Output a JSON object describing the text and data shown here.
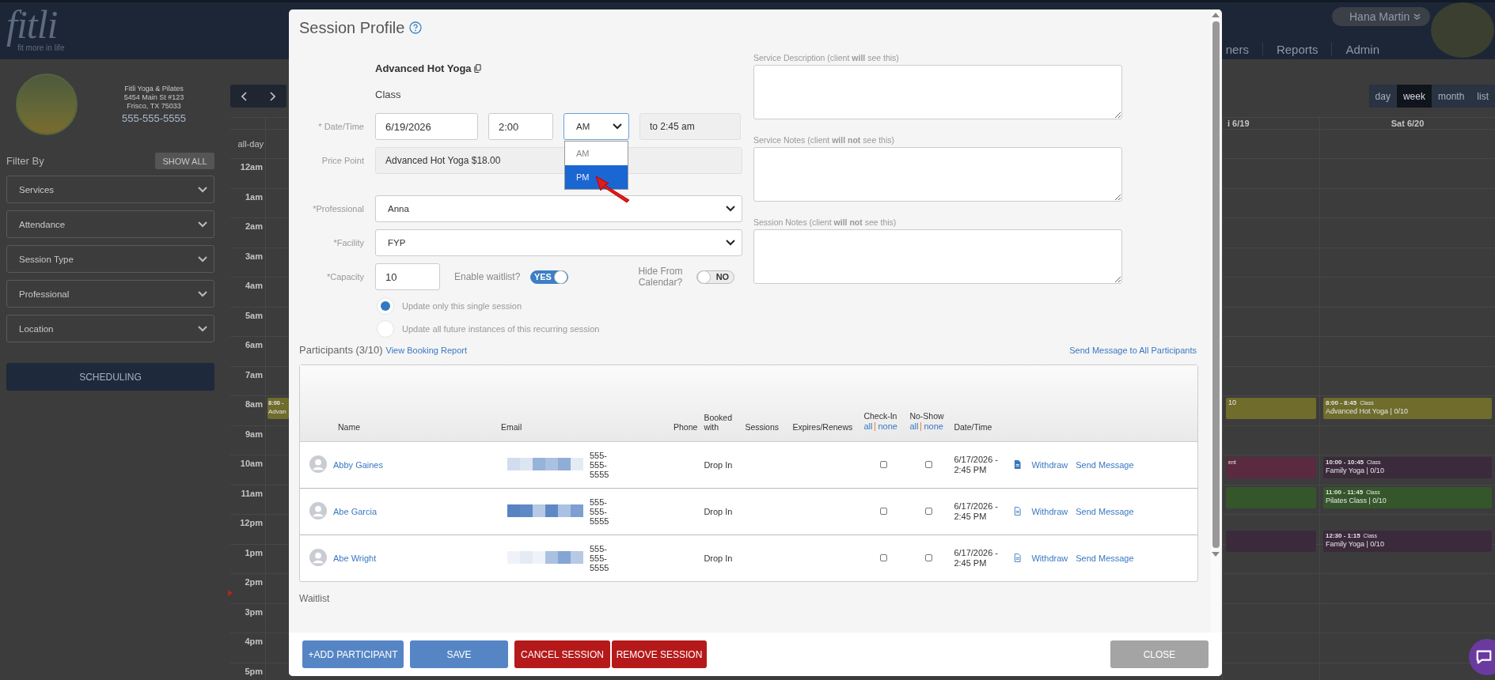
{
  "header": {
    "logo": "fitli",
    "tagline": "fit more in life",
    "nav": [
      "ners",
      "Reports",
      "Admin"
    ],
    "user": "Hana Martin"
  },
  "sidebar": {
    "business_name": "Fitli Yoga & Pilates",
    "address": "5454 Main St #123",
    "city": "Frisco, TX 75033",
    "phone": "555-555-5555",
    "filter_label": "Filter By",
    "show_all": "SHOW ALL",
    "filters": [
      "Services",
      "Attendance",
      "Session Type",
      "Professional",
      "Location"
    ],
    "scheduling": "SCHEDULING"
  },
  "calendar": {
    "views": [
      {
        "label": "day",
        "selected": false
      },
      {
        "label": "week",
        "selected": true
      },
      {
        "label": "month",
        "selected": false
      },
      {
        "label": "list",
        "selected": false
      }
    ],
    "days": {
      "fri": "i 6/19",
      "sat": "Sat 6/20"
    },
    "all_day": "all-day",
    "hours": [
      {
        "label": "12am"
      },
      {
        "label": "1am"
      },
      {
        "label": "2am"
      },
      {
        "label": "3am"
      },
      {
        "label": "4am"
      },
      {
        "label": "5am"
      },
      {
        "label": "6am"
      },
      {
        "label": "7am"
      },
      {
        "label": "8am",
        "sun": {
          "kind": "on-hour",
          "time": "8:00 -",
          "title": "Advan",
          "color": "#6f6c2c"
        },
        "fri": {
          "kind": "on-hour",
          "title": "10",
          "color": "#6f6c2c"
        },
        "sat": {
          "kind": "on-hour",
          "time": "8:00 - 8:45",
          "type": "Class",
          "title": "Advanced Hot Yoga | 0/10",
          "color": "#6f6c2c"
        }
      },
      {
        "label": "9am"
      },
      {
        "label": "10am",
        "fri": {
          "kind": "on-hour",
          "type": "ent",
          "color": "#5a2a40"
        },
        "sat": {
          "kind": "on-hour",
          "time": "10:00 - 10:45",
          "type": "Class",
          "title": "Family Yoga | 0/10",
          "color": "#3b2a3c"
        }
      },
      {
        "label": "11am",
        "fri": {
          "kind": "on-hour",
          "color": "#35562b"
        },
        "sat": {
          "kind": "on-hour",
          "time": "11:00 - 11:45",
          "type": "Class",
          "title": "Pilates Class | 0/10",
          "color": "#35562b"
        }
      },
      {
        "label": "12pm",
        "fri": {
          "kind": "half-past",
          "color": "#3b2a3c"
        },
        "sat": {
          "kind": "half-past",
          "time": "12:30 - 1:15",
          "type": "Class",
          "title": "Family Yoga | 0/10",
          "color": "#3b2a3c"
        }
      },
      {
        "label": "1pm"
      },
      {
        "label": "2pm"
      },
      {
        "label": "3pm"
      },
      {
        "label": "4pm"
      },
      {
        "label": "5pm"
      }
    ]
  },
  "modal": {
    "title": "Session Profile",
    "service_name": "Advanced Hot Yoga",
    "service_type": "Class",
    "date_label": "* Date/Time",
    "date": "6/19/2026",
    "time": "2:00",
    "meridiem": "AM",
    "meridiem_options": [
      {
        "label": "AM",
        "selected": false
      },
      {
        "label": "PM",
        "selected": true
      }
    ],
    "end_time": "to 2:45 am",
    "price_label": "Price Point",
    "price": "Advanced Hot Yoga $18.00",
    "professional_label": "*Professional",
    "professional": "Anna",
    "facility_label": "*Facility",
    "facility": "FYP",
    "capacity_label": "*Capacity",
    "capacity": "10",
    "waitlist_label": "Enable waitlist?",
    "waitlist": {
      "label": "YES",
      "on": true
    },
    "hide_label": "Hide From Calendar?",
    "hide": {
      "label": "NO",
      "on": false
    },
    "update_options": [
      {
        "label": "Update only this single session",
        "selected": true
      },
      {
        "label": "Update all future instances of this recurring session",
        "selected": false
      }
    ],
    "notes": [
      {
        "label": "Service Description (client **will** see this)"
      },
      {
        "label": "Service Notes (client **will not** see this)"
      },
      {
        "label": "Session Notes (client **will not** see this)"
      }
    ],
    "participants_title": "Participants (3/10)",
    "booking_report": "View Booking Report",
    "send_all": "Send Message to All Participants",
    "columns": {
      "name": "Name",
      "email": "Email",
      "phone": "Phone",
      "booked": "Booked with",
      "sessions": "Sessions",
      "expires": "Expires/Renews",
      "check_in": "Check-In",
      "check_in_all": "all",
      "check_in_none": "none",
      "no_show": "No-Show",
      "no_show_all": "all",
      "no_show_none": "none",
      "datetime": "Date/Time"
    },
    "participants": [
      {
        "name": "Abby Gaines",
        "phone": "555-555-5555",
        "booked": "Drop In",
        "checked_in": false,
        "no_show": false,
        "datetime": "6/17/2026 - 2:45 PM",
        "note_filled": true,
        "withdraw": "Withdraw",
        "message": "Send Message"
      },
      {
        "name": "Abe Garcia",
        "phone": "555-555-5555",
        "booked": "Drop In",
        "checked_in": false,
        "no_show": false,
        "datetime": "6/17/2026 - 2:45 PM",
        "note_filled": false,
        "withdraw": "Withdraw",
        "message": "Send Message"
      },
      {
        "name": "Abe Wright",
        "phone": "555-555-5555",
        "booked": "Drop In",
        "checked_in": false,
        "no_show": false,
        "datetime": "6/17/2026 - 2:45 PM",
        "note_filled": false,
        "withdraw": "Withdraw",
        "message": "Send Message"
      }
    ],
    "waitlist_title": "Waitlist",
    "buttons": [
      {
        "label": "+ADD PARTICIPANT",
        "kind": "primary"
      },
      {
        "label": "SAVE",
        "kind": "primary"
      },
      {
        "label": "CANCEL SESSION",
        "kind": "danger"
      },
      {
        "label": "REMOVE SESSION",
        "kind": "danger"
      },
      {
        "label": "CLOSE",
        "kind": "muted"
      }
    ]
  }
}
